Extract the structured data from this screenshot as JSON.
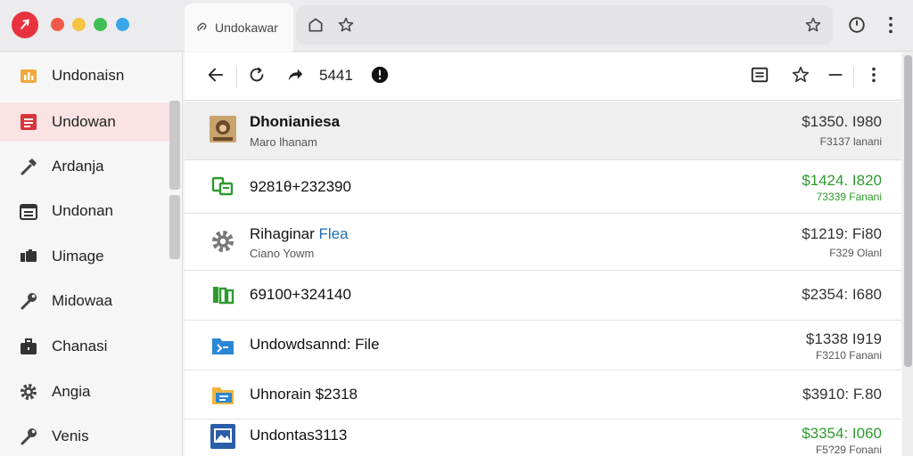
{
  "window": {
    "tab_title": "Undokawar",
    "colors": {
      "logo": "#e8333e",
      "active_sidebar": "#fbe3e4",
      "accent_green": "#2e9a2e",
      "accent_blue": "#1f6fb5"
    }
  },
  "sidebar": {
    "items": [
      {
        "label": "Undonaisn",
        "icon": "folder-chart-icon"
      },
      {
        "label": "Undowan",
        "icon": "document-red-icon",
        "active": true
      },
      {
        "label": "Ardanja",
        "icon": "hammer-icon"
      },
      {
        "label": "Undonan",
        "icon": "calendar-icon"
      },
      {
        "label": "Uimage",
        "icon": "image-icon"
      },
      {
        "label": "Midowaa",
        "icon": "wrench-icon"
      },
      {
        "label": "Chanasi",
        "icon": "briefcase-icon"
      },
      {
        "label": "Angia",
        "icon": "gear-icon"
      },
      {
        "label": "Venis",
        "icon": "wrench-icon"
      }
    ]
  },
  "toolbar": {
    "count": "5441"
  },
  "rows": [
    {
      "name": "Dhonianiesa",
      "sub": "Maro lhanam",
      "amount": "$1350. I980",
      "amount_sub": "F3137 lanani",
      "icon": "photo-thumb-icon",
      "amount_color": "default",
      "selected": true
    },
    {
      "name": "9281θ+232390",
      "sub": "",
      "amount": "$1424. I820",
      "amount_sub": "73339 Fanani",
      "icon": "spreadsheet-icon",
      "amount_color": "green"
    },
    {
      "name": "Rihaginar",
      "name_suffix": "Flea",
      "sub": "Ciano Yowm",
      "amount": "$1219: Fi80",
      "amount_sub": "F329 Olanl",
      "icon": "gear-icon",
      "amount_color": "default"
    },
    {
      "name": "69100+324140",
      "sub": "",
      "amount": "$2354: I680",
      "amount_sub": "",
      "icon": "spreadsheet-icon",
      "amount_color": "default"
    },
    {
      "name": "Undowdsannd: File",
      "sub": "",
      "amount": "$1338 I919",
      "amount_sub": "F3210 Fanani",
      "icon": "folder-blue-icon",
      "amount_color": "default"
    },
    {
      "name": "Uhnorain $2318",
      "sub": "",
      "amount": "$3910: F.80",
      "amount_sub": "",
      "icon": "folder-yellow-icon",
      "amount_color": "default"
    },
    {
      "name": "Undontas3113",
      "sub": "",
      "amount": "$3354: I060",
      "amount_sub": "F5?29 Fonani",
      "icon": "image-file-icon",
      "amount_color": "green"
    }
  ]
}
